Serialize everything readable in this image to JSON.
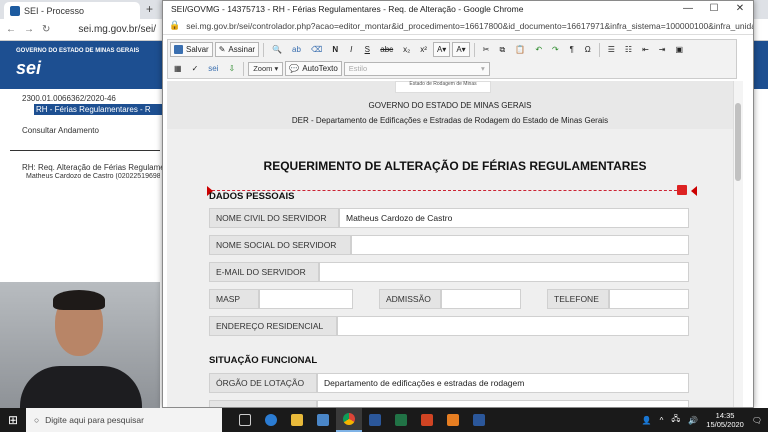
{
  "browser_bg": {
    "tab_title": "SEI - Processo",
    "url": "sei.mg.gov.br/sei/",
    "gov_label": "GOVERNO DO ESTADO DE MINAS GERAIS",
    "logo": "sei",
    "process_number": "2300.01.0066362/2020-46",
    "selected_doc": "RH - Férias Regulamentares - R",
    "consultar": "Consultar Andamento",
    "req_title": "RH: Req. Alteração de Férias Regulame",
    "req_user": "Matheus Cardozo de Castro (02022519698)"
  },
  "popup": {
    "title": "SEI/GOVMG - 14375713 - RH - Férias Regulamentares - Req. de Alteração - Google Chrome",
    "url": "sei.mg.gov.br/sei/controlador.php?acao=editor_montar&id_procedimento=16617800&id_documento=16617971&infra_sistema=100000100&infra_unidade_atu...",
    "window_buttons": [
      "—",
      "☐",
      "✕"
    ]
  },
  "toolbar": {
    "salvar": "Salvar",
    "assinar": "Assinar",
    "zoom": "Zoom",
    "autotexto": "AutoTexto",
    "estilo": "Estilo"
  },
  "document": {
    "brasao_text": "Estado de Rodagem de Minas",
    "gov": "GOVERNO DO ESTADO DE MINAS GERAIS",
    "der": "DER - Departamento de Edificações e Estradas de Rodagem do Estado de Minas Gerais",
    "heading": "REQUERIMENTO DE ALTERAÇÃO DE FÉRIAS REGULAMENTARES",
    "section1": "DADOS PESSOAIS",
    "nome_civil_label": "NOME CIVIL DO SERVIDOR",
    "nome_civil_value": "Matheus Cardozo de Castro",
    "nome_social_label": "NOME SOCIAL DO SERVIDOR",
    "email_label": "E-MAIL DO SERVIDOR",
    "masp_label": "MASP",
    "admissao_label": "ADMISSÃO",
    "telefone_label": "TELEFONE",
    "endereco_label": "ENDEREÇO RESIDENCIAL",
    "section2": "SITUAÇÃO FUNCIONAL",
    "orgao_label": "ÓRGÃO DE LOTAÇÃO",
    "orgao_value": "Departamento de edificações e estradas de rodagem"
  },
  "taskbar": {
    "search_placeholder": "Digite aqui para pesquisar",
    "time": "14:35",
    "date": "15/05/2020"
  }
}
